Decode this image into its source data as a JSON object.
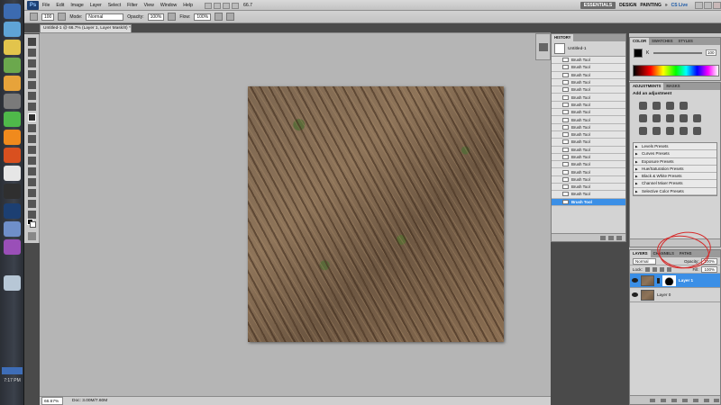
{
  "menubar": {
    "logo": "Ps",
    "items": [
      "File",
      "Edit",
      "Image",
      "Layer",
      "Select",
      "Filter",
      "View",
      "Window",
      "Help"
    ],
    "zoom_display": "66.7",
    "workspaces": [
      "ESSENTIALS",
      "DESIGN",
      "PAINTING"
    ],
    "cslive": "CS Live"
  },
  "optionsbar": {
    "brush_size": "100",
    "mode_label": "Mode:",
    "mode_value": "Normal",
    "opacity_label": "Opacity:",
    "opacity_value": "100%",
    "flow_label": "Flow:",
    "flow_value": "100%"
  },
  "document": {
    "tab_title": "Untitled-1 @ 66.7% (Layer 1, Layer Mask/8) *"
  },
  "status": {
    "zoom": "66.67%",
    "doc": "Doc: 3.00M/7.60M"
  },
  "history": {
    "tabs": [
      "HISTORY"
    ],
    "snapshot": "Untitled-1",
    "items": [
      "Brush Tool",
      "Brush Tool",
      "Brush Tool",
      "Brush Tool",
      "Brush Tool",
      "Brush Tool",
      "Brush Tool",
      "Brush Tool",
      "Brush Tool",
      "Brush Tool",
      "Brush Tool",
      "Brush Tool",
      "Brush Tool",
      "Brush Tool",
      "Brush Tool",
      "Brush Tool",
      "Brush Tool",
      "Brush Tool",
      "Brush Tool",
      "Brush Tool"
    ]
  },
  "color_panel": {
    "tabs": [
      "COLOR",
      "SWATCHES",
      "STYLES"
    ],
    "channel": "K",
    "value": "100"
  },
  "adjustments": {
    "tabs": [
      "ADJUSTMENTS",
      "MASKS"
    ],
    "header": "Add an adjustment",
    "presets": [
      "Levels Presets",
      "Curves Presets",
      "Exposure Presets",
      "Hue/Saturation Presets",
      "Black & White Presets",
      "Channel Mixer Presets",
      "Selective Color Presets"
    ]
  },
  "layers": {
    "tabs": [
      "LAYERS",
      "CHANNELS",
      "PATHS"
    ],
    "blend": "Normal",
    "opacity_label": "Opacity:",
    "opacity_value": "100%",
    "lock_label": "Lock:",
    "fill_label": "Fill:",
    "fill_value": "100%",
    "items": [
      {
        "name": "Layer 1",
        "selected": true
      },
      {
        "name": "Layer 0",
        "selected": false
      }
    ]
  },
  "taskbar": {
    "time": "7:17 PM"
  }
}
